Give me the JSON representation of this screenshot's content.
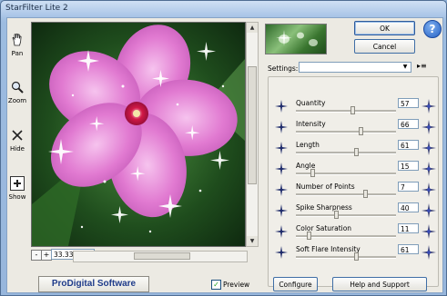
{
  "window": {
    "title": "StarFilter Lite 2"
  },
  "tools": [
    {
      "label": "Pan",
      "icon": "hand-icon"
    },
    {
      "label": "Zoom",
      "icon": "magnifier-icon"
    },
    {
      "label": "Hide",
      "icon": "x-icon"
    },
    {
      "label": "Show",
      "icon": "plus-box-icon"
    }
  ],
  "preview": {
    "zoom": "33.33%",
    "zoom_minus": "-",
    "zoom_plus": "+",
    "logo": "ProDigital Software",
    "preview_label": "Preview",
    "preview_checked": true
  },
  "buttons": {
    "ok": "OK",
    "cancel": "Cancel",
    "configure": "Configure",
    "help_support": "Help and Support",
    "help_icon": "?"
  },
  "settings": {
    "label": "Settings:",
    "value": ""
  },
  "params": [
    {
      "label": "Quantity",
      "value": "57",
      "level": 0.57
    },
    {
      "label": "Intensity",
      "value": "66",
      "level": 0.66
    },
    {
      "label": "Length",
      "value": "61",
      "level": 0.61
    },
    {
      "label": "Angle",
      "value": "15",
      "level": 0.15
    },
    {
      "label": "Number of Points",
      "value": "7",
      "level": 0.7
    },
    {
      "label": "Spike Sharpness",
      "value": "40",
      "level": 0.4
    },
    {
      "label": "Color Saturation",
      "value": "11",
      "level": 0.11
    },
    {
      "label": "Soft Flare Intensity",
      "value": "61",
      "level": 0.61
    }
  ],
  "colors": {
    "accent": "#2e5a9a",
    "flower": "#e07ad0",
    "leaf": "#3a7a32"
  }
}
